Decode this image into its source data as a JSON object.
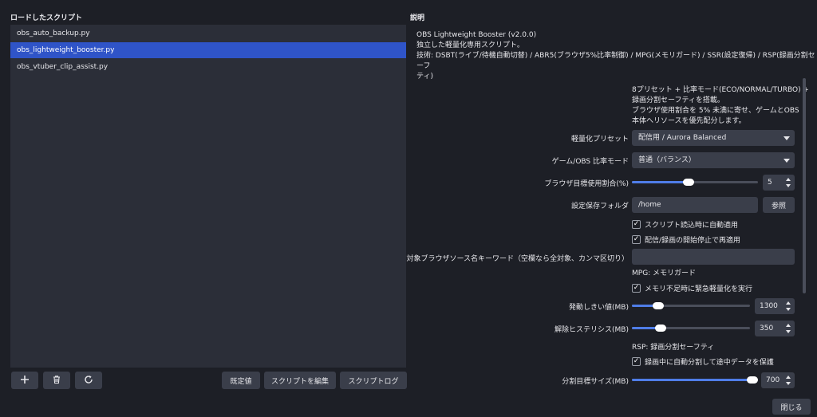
{
  "left": {
    "title": "ロードしたスクリプト",
    "scripts": [
      "obs_auto_backup.py",
      "obs_lightweight_booster.py",
      "obs_vtuber_clip_assist.py"
    ],
    "selected_index": 1,
    "buttons": {
      "defaults": "既定値",
      "edit": "スクリプトを編集",
      "log": "スクリプトログ"
    },
    "icons": {
      "add": "plus-icon",
      "remove": "trash-icon",
      "reload": "reload-icon"
    }
  },
  "right": {
    "title": "説明",
    "description": [
      "OBS Lightweight Booster (v2.0.0)",
      "独立した軽量化専用スクリプト。",
      "技術: DSBT(ライブ/待機自動切替) / ABR5(ブラウザ5%比率制御) / MPG(メモリガード) / SSR(設定復帰) / RSP(録画分割セーフ",
      "ティ)"
    ],
    "intro": [
      "8プリセット + 比率モード(ECO/NORMAL/TURBO) +",
      "録画分割セーフティを搭載。",
      "ブラウザ使用割合を 5% 未満に寄せ、ゲームとOBS",
      "本体へリソースを優先配分します。"
    ],
    "preset": {
      "label": "軽量化プリセット",
      "value": "配信用 / Aurora Balanced"
    },
    "ratio_mode": {
      "label": "ゲーム/OBS 比率モード",
      "value": "普通（バランス）"
    },
    "browser_target": {
      "label": "ブラウザ目標使用割合(%)",
      "value": "5",
      "fraction": 0.45
    },
    "folder": {
      "label": "設定保存フォルダ",
      "value": "/home",
      "browse": "参照"
    },
    "check_auto_apply": {
      "label": "スクリプト読込時に自動適用",
      "checked": true
    },
    "check_reapply": {
      "label": "配信/録画の開始停止で再適用",
      "checked": true
    },
    "keywords": {
      "label": "対象ブラウザソース名キーワード（空欄なら全対象、カンマ区切り）",
      "value": ""
    },
    "mpg_heading": "MPG: メモリガード",
    "check_emergency": {
      "label": "メモリ不足時に緊急軽量化を実行",
      "checked": true
    },
    "trigger": {
      "label": "発動しきい値(MB)",
      "value": "1300",
      "fraction": 0.22
    },
    "release": {
      "label": "解除ヒステリシス(MB)",
      "value": "350",
      "fraction": 0.24
    },
    "rsp_heading": "RSP: 録画分割セーフティ",
    "check_split": {
      "label": "録画中に自動分割して途中データを保護",
      "checked": true
    },
    "split_target": {
      "label": "分割目標サイズ(MB)",
      "value": "700",
      "fraction": 0.97
    },
    "close_button": "閉じる"
  },
  "colors": {
    "accent": "#2f54c8",
    "slider_fill": "#4f7de8",
    "background": "#1d1f26"
  }
}
